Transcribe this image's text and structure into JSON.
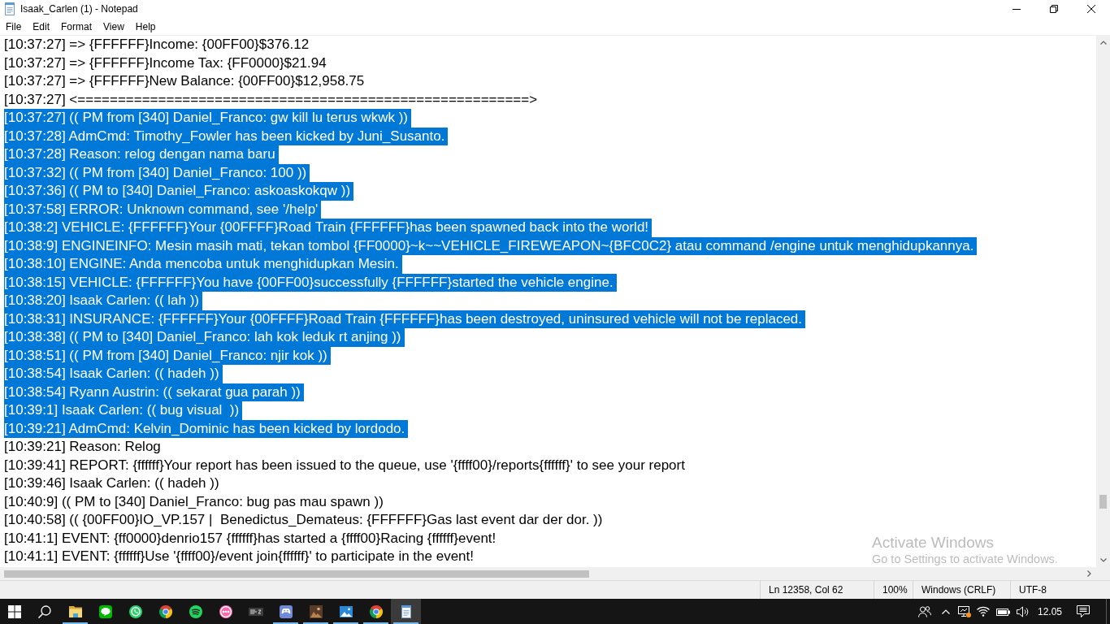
{
  "window": {
    "title": "Isaak_Carlen (1) - Notepad"
  },
  "menu": [
    "File",
    "Edit",
    "Format",
    "View",
    "Help"
  ],
  "editor": {
    "lines": [
      {
        "text": "[10:37:27] => {FFFFFF}Income: {00FF00}$376.12",
        "selected": false
      },
      {
        "text": "[10:37:27] => {FFFFFF}Income Tax: {FF0000}$21.94",
        "selected": false
      },
      {
        "text": "[10:37:27] => {FFFFFF}New Balance: {00FF00}$12,958.75",
        "selected": false
      },
      {
        "text": "[10:37:27] <========================================================>",
        "selected": false
      },
      {
        "text": "[10:37:27] (( PM from [340] Daniel_Franco: gw kill lu terus wkwk ))",
        "selected": true
      },
      {
        "text": "[10:37:28] AdmCmd: Timothy_Fowler has been kicked by Juni_Susanto.",
        "selected": true
      },
      {
        "text": "[10:37:28] Reason: relog dengan nama baru",
        "selected": true
      },
      {
        "text": "[10:37:32] (( PM from [340] Daniel_Franco: 100 ))",
        "selected": true
      },
      {
        "text": "[10:37:36] (( PM to [340] Daniel_Franco: askoaskokqw ))",
        "selected": true
      },
      {
        "text": "[10:37:58] ERROR: Unknown command, see '/help'",
        "selected": true
      },
      {
        "text": "[10:38:2] VEHICLE: {FFFFFF}Your {00FFFF}Road Train {FFFFFF}has been spawned back into the world!",
        "selected": true
      },
      {
        "text": "[10:38:9] ENGINEINFO: Mesin masih mati, tekan tombol {FF0000}~k~~VEHICLE_FIREWEAPON~{BFC0C2} atau command /engine untuk menghidupkannya.",
        "selected": true
      },
      {
        "text": "[10:38:10] ENGINE: Anda mencoba untuk menghidupkan Mesin.",
        "selected": true
      },
      {
        "text": "[10:38:15] VEHICLE: {FFFFFF}You have {00FF00}successfully {FFFFFF}started the vehicle engine.",
        "selected": true
      },
      {
        "text": "[10:38:20] Isaak Carlen: (( lah ))",
        "selected": true
      },
      {
        "text": "[10:38:31] INSURANCE: {FFFFFF}Your {00FFFF}Road Train {FFFFFF}has been destroyed, uninsured vehicle will not be replaced.",
        "selected": true
      },
      {
        "text": "[10:38:38] (( PM to [340] Daniel_Franco: lah kok leduk rt anjing ))",
        "selected": true
      },
      {
        "text": "[10:38:51] (( PM from [340] Daniel_Franco: njir kok ))",
        "selected": true
      },
      {
        "text": "[10:38:54] Isaak Carlen: (( hadeh ))",
        "selected": true
      },
      {
        "text": "[10:38:54] Ryann Austrin: (( sekarat gua parah ))",
        "selected": true
      },
      {
        "text": "[10:39:1] Isaak Carlen: (( bug visual  ))",
        "selected": true
      },
      {
        "text": "[10:39:21] AdmCmd: Kelvin_Dominic has been kicked by lordodo.",
        "selected": true
      },
      {
        "text": "[10:39:21] Reason: Relog",
        "selected": false
      },
      {
        "text": "[10:39:41] REPORT: {ffffff}Your report has been issued to the queue, use '{ffff00}/reports{ffffff}' to see your report",
        "selected": false
      },
      {
        "text": "[10:39:46] Isaak Carlen: (( hadeh ))",
        "selected": false
      },
      {
        "text": "[10:40:9] (( PM to [340] Daniel_Franco: bug pas mau spawn ))",
        "selected": false
      },
      {
        "text": "[10:40:58] (( {00FF00}IO_VP.157 |  Benedictus_Demateus: {FFFFFF}Gas last event dar der dor. ))",
        "selected": false
      },
      {
        "text": "[10:41:1] EVENT: {ff0000}denrio157 {ffffff}has started a {ffff00}Racing {ffffff}event!",
        "selected": false
      },
      {
        "text": "[10:41:1] EVENT: {ffffff}Use '{ffff00}/event join{ffffff}' to participate in the event!",
        "selected": false
      }
    ]
  },
  "status_bar": {
    "position": "Ln 12358, Col 62",
    "zoom": "100%",
    "line_ending": "Windows (CRLF)",
    "encoding": "UTF-8"
  },
  "activation_notice": {
    "title": "Activate Windows",
    "message": "Go to Settings to activate Windows."
  },
  "taskbar": {
    "apps": [
      {
        "kind": "folder",
        "running": true,
        "active": false
      },
      {
        "kind": "chat",
        "running": false,
        "active": false
      },
      {
        "kind": "phone",
        "running": false,
        "active": false
      },
      {
        "kind": "browser",
        "running": false,
        "active": false
      },
      {
        "kind": "music",
        "running": false,
        "active": false
      },
      {
        "kind": "ring",
        "running": false,
        "active": false
      },
      {
        "kind": "tile",
        "running": false,
        "active": false
      },
      {
        "kind": "gamepad",
        "running": true,
        "active": false
      },
      {
        "kind": "picture",
        "running": true,
        "active": false
      },
      {
        "kind": "photos",
        "running": true,
        "active": false
      },
      {
        "kind": "browser",
        "running": true,
        "active": false
      },
      {
        "kind": "notepad",
        "running": true,
        "active": true
      }
    ],
    "clock": "12.05"
  }
}
